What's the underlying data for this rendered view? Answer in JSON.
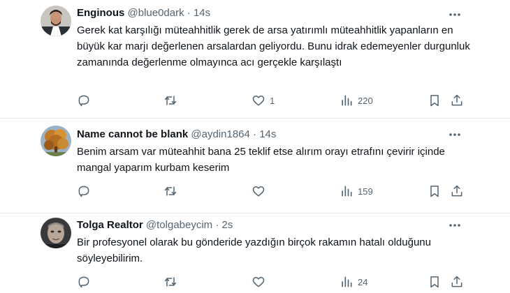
{
  "tweets": [
    {
      "display_name": "Enginous",
      "handle": "@blue0dark",
      "separator": "·",
      "time": "14s",
      "text": "Gerek kat karşılığı müteahhitlik gerek de arsa yatırımlı müteahhitlik yapanların en büyük kar marjı değerlenen arsalardan geliyordu. Bunu idrak edemeyenler durgunluk zamanında değerlenme olmayınca acı gerçekle karşılaştı",
      "likes": "1",
      "views": "220"
    },
    {
      "display_name": "Name cannot be blank",
      "handle": "@aydin1864",
      "separator": "·",
      "time": "14s",
      "text": "Benim arsam var müteahhit  bana 25 teklif etse alırım orayı etrafını çevirir içinde  mangal yaparım kurbam keserim",
      "likes": "",
      "views": "159"
    },
    {
      "display_name": "Tolga Realtor",
      "handle": "@tolgabeycim",
      "separator": "·",
      "time": "2s",
      "text": "Bir profesyonel olarak bu gönderide yazdığın birçok rakamın hatalı olduğunu söyleyebilirim.",
      "likes": "",
      "views": "24"
    }
  ],
  "colors": {
    "text": "#0f1419",
    "secondary": "#536471",
    "divider": "#e6ecf0"
  },
  "icons": [
    "reply-icon",
    "retweet-icon",
    "like-icon",
    "views-icon",
    "bookmark-icon",
    "share-icon",
    "more-icon"
  ]
}
